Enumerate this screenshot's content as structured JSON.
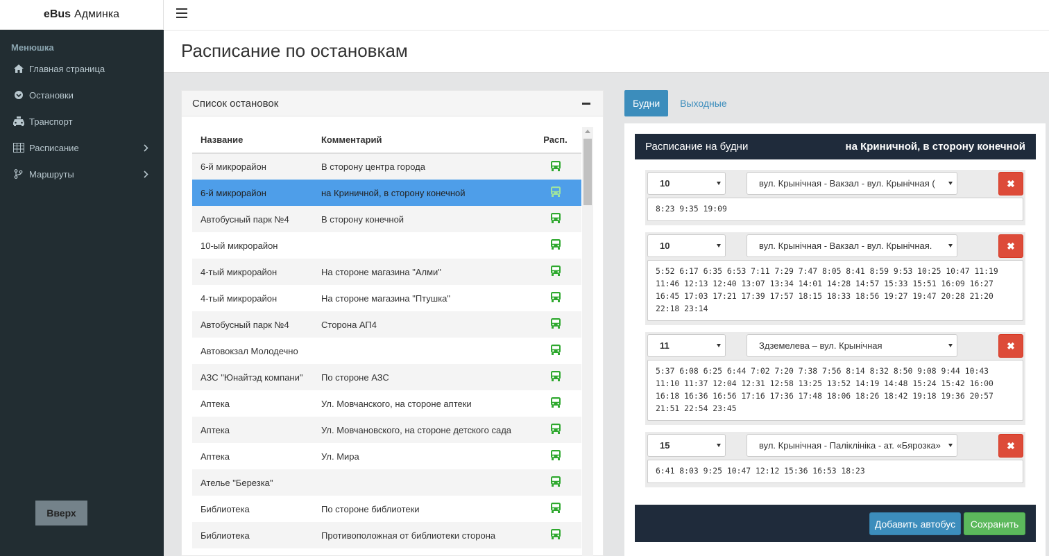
{
  "brand": {
    "bold": "eBus",
    "rest": "Админка"
  },
  "sidebar": {
    "title": "Менюшка",
    "items": [
      {
        "label": "Главная страница",
        "icon": "home-icon"
      },
      {
        "label": "Остановки",
        "icon": "stop-icon"
      },
      {
        "label": "Транспорт",
        "icon": "taxi-icon"
      },
      {
        "label": "Расписание",
        "icon": "table-icon",
        "has_submenu": true
      },
      {
        "label": "Маршруты",
        "icon": "route-icon",
        "has_submenu": true
      }
    ],
    "top_button": "Вверх"
  },
  "page": {
    "title": "Расписание по остановкам"
  },
  "stops_panel": {
    "title": "Список остановок",
    "columns": [
      "Название",
      "Комментарий",
      "Расп."
    ],
    "rows": [
      {
        "name": "6-й микрорайон",
        "comment": "В сторону центра города"
      },
      {
        "name": "6-й микрорайон",
        "comment": "на Криничной, в сторону конечной",
        "selected": true
      },
      {
        "name": "Автобусный парк №4",
        "comment": "В сторону конечной"
      },
      {
        "name": "10-ый микрорайон",
        "comment": ""
      },
      {
        "name": "4-тый микрорайон",
        "comment": "На стороне магазина \"Алми\""
      },
      {
        "name": "4-тый микрорайон",
        "comment": "На стороне магазина \"Птушка\""
      },
      {
        "name": "Автобусный парк №4",
        "comment": "Сторона АП4"
      },
      {
        "name": "Автовокзал Молодечно",
        "comment": ""
      },
      {
        "name": "АЗС \"Юнайтэд компани\"",
        "comment": "По стороне АЗС"
      },
      {
        "name": "Аптека",
        "comment": "Ул. Мовчанского, на стороне аптеки"
      },
      {
        "name": "Аптека",
        "comment": "Ул. Мовчановского, на стороне детского сада"
      },
      {
        "name": "Аптека",
        "comment": "Ул. Мира"
      },
      {
        "name": "Ателье \"Березка\"",
        "comment": ""
      },
      {
        "name": "Библиотека",
        "comment": "По стороне библиотеки"
      },
      {
        "name": "Библиотека",
        "comment": "Противоположная от библиотеки сторона"
      }
    ],
    "bus_icon_color": "#2ea82e",
    "selected_color": "#4e9ee9"
  },
  "tabs": {
    "weekdays": "Будни",
    "weekends": "Выходные"
  },
  "schedule": {
    "title": "Расписание на будни",
    "direction": "на Криничной, в сторону конечной",
    "entries": [
      {
        "number": "10",
        "route": "вул. Крынічная - Вакзал - вул. Крынічная (",
        "times": "8:23 9:35 19:09"
      },
      {
        "number": "10",
        "route": "вул. Крынічная - Вакзал - вул. Крынічная.",
        "times": "5:52 6:17 6:35 6:53 7:11 7:29 7:47 8:05 8:41 8:59 9:53 10:25 10:47 11:19 11:46 12:13 12:40 13:07 13:34 14:01 14:28 14:57 15:33 15:51 16:09 16:27 16:45 17:03 17:21 17:39 17:57 18:15 18:33 18:56 19:27 19:47 20:28 21:20 22:18 23:14"
      },
      {
        "number": "11",
        "route": "Здземелева – вул. Крынічная",
        "times": "5:37 6:08 6:25 6:44 7:02 7:20 7:38 7:56 8:14 8:32 8:50 9:08 9:44 10:43 11:10 11:37 12:04 12:31 12:58 13:25 13:52 14:19 14:48 15:24 15:42 16:00 16:18 16:36 16:56 17:16 17:36 17:48 18:06 18:26 18:42 19:18 19:36 20:57 21:51 22:54 23:45"
      },
      {
        "number": "15",
        "route": "вул. Крынічная - Паліклініка - ат. «Бярозка»",
        "times": "6:41 8:03 9:25 10:47 12:12 15:36 16:53 18:23"
      }
    ],
    "delete_symbol": "✖",
    "add_bus": "Добавить автобус",
    "save": "Сохранить"
  }
}
